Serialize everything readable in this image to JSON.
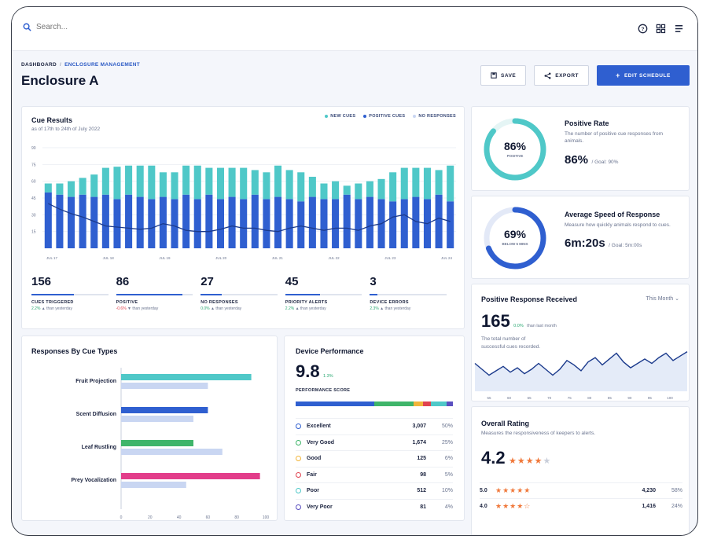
{
  "search": {
    "placeholder": "Search..."
  },
  "breadcrumb": {
    "root": "DASHBOARD",
    "current": "ENCLOSURE MANAGEMENT"
  },
  "page": {
    "title": "Enclosure A"
  },
  "actions": {
    "save": "SAVE",
    "export": "EXPORT",
    "edit": "EDIT SCHEDULE"
  },
  "colors": {
    "primary": "#2f5fd0",
    "teal": "#4fc8c8",
    "lightBlue": "#c9d6f2",
    "green": "#3fb56a",
    "pink": "#e23d8a",
    "orange": "#f0783a"
  },
  "cue_results": {
    "title": "Cue Results",
    "subtitle": "as of 17th to 24th of July 2022",
    "legend": [
      "NEW CUES",
      "POSITIVE CUES",
      "NO RESPONSES"
    ]
  },
  "stats": [
    {
      "value": "156",
      "label": "CUES TRIGGERED",
      "change": "2.2%",
      "change_suffix": "than yesterday",
      "dir": "up",
      "fill": 0.55
    },
    {
      "value": "86",
      "label": "POSITIVE",
      "change": "-0.6%",
      "change_suffix": "than yesterday",
      "dir": "down",
      "fill": 0.86
    },
    {
      "value": "27",
      "label": "NO RESPONSES",
      "change": "0.0%",
      "change_suffix": "than yesterday",
      "dir": "up",
      "fill": 0.27
    },
    {
      "value": "45",
      "label": "PRIORITY ALERTS",
      "change": "2.2%",
      "change_suffix": "than yesterday",
      "dir": "up",
      "fill": 0.45
    },
    {
      "value": "3",
      "label": "DEVICE ERRORS",
      "change": "2.3%",
      "change_suffix": "than yesterday",
      "dir": "up",
      "fill": 0.1
    }
  ],
  "positive_rate": {
    "ring_value": "86%",
    "ring_label": "POSITIVE",
    "title": "Positive Rate",
    "desc": "The number of positive cue responses from animals.",
    "big": "86%",
    "goal": "/ Goal: 90%",
    "fraction": 0.86
  },
  "speed": {
    "ring_value": "69%",
    "ring_label": "BELOW 5 MINS",
    "title": "Average Speed of Response",
    "desc": "Measure how quickly animals respond to cues.",
    "big": "6m:20s",
    "goal": "/ Goal: 5m:00s",
    "fraction": 0.69
  },
  "response_received": {
    "title": "Positive Response Received",
    "period": "This Month",
    "value": "165",
    "change": "0.0%",
    "change_suffix": "than last month",
    "desc_line1": "The total number of",
    "desc_line2": "successful cues recorded."
  },
  "overall": {
    "title": "Overall Rating",
    "desc": "Measures the responsiveness of keepers to alerts.",
    "value": "4.2",
    "rows": [
      {
        "score": "5.0",
        "stars": "★★★★★",
        "count": "4,230",
        "pct": "58%"
      },
      {
        "score": "4.0",
        "stars": "★★★★☆",
        "count": "1,416",
        "pct": "24%"
      }
    ]
  },
  "device_performance": {
    "title": "Device Performance",
    "score": "9.8",
    "score_change": "1.3%",
    "score_label": "PERFORMANCE SCORE",
    "rows": [
      {
        "name": "Excellent",
        "count": "3,007",
        "pct": "50%",
        "color": "#2f5fd0"
      },
      {
        "name": "Very Good",
        "count": "1,674",
        "pct": "25%",
        "color": "#3fb56a"
      },
      {
        "name": "Good",
        "count": "125",
        "pct": "6%",
        "color": "#f2b53a"
      },
      {
        "name": "Fair",
        "count": "98",
        "pct": "5%",
        "color": "#e0424f"
      },
      {
        "name": "Poor",
        "count": "512",
        "pct": "10%",
        "color": "#4fc8c8"
      },
      {
        "name": "Very Poor",
        "count": "81",
        "pct": "4%",
        "color": "#5a4fc0"
      }
    ]
  },
  "chart_data": [
    {
      "type": "bar",
      "title": "Cue Results",
      "ylim": [
        0,
        90
      ],
      "yticks": [
        "90",
        "75",
        "60",
        "45",
        "30",
        "15"
      ],
      "xtick_labels": [
        "JUL 17",
        "JUL 18",
        "JUL 19",
        "JUL 20",
        "JUL 21",
        "JUL 22",
        "JUL 23",
        "JUL 24"
      ],
      "series": [
        {
          "name": "POSITIVE CUES",
          "values": [
            50,
            48,
            46,
            48,
            46,
            48,
            44,
            48,
            46,
            44,
            46,
            44,
            48,
            44,
            48,
            44,
            46,
            44,
            48,
            44,
            46,
            44,
            42,
            46,
            44,
            44,
            48,
            44,
            46,
            44,
            42,
            44,
            46,
            44,
            48,
            42
          ]
        },
        {
          "name": "NEW CUES",
          "values": [
            8,
            10,
            14,
            15,
            20,
            24,
            29,
            26,
            28,
            30,
            22,
            24,
            26,
            30,
            24,
            28,
            26,
            28,
            22,
            24,
            28,
            26,
            26,
            18,
            14,
            16,
            8,
            14,
            14,
            18,
            26,
            28,
            26,
            28,
            22,
            32
          ]
        },
        {
          "name": "NO RESPONSES",
          "values": [
            40,
            35,
            31,
            28,
            24,
            20,
            19,
            18,
            17,
            18,
            22,
            20,
            16,
            15,
            15,
            17,
            20,
            18,
            18,
            16,
            15,
            18,
            20,
            18,
            16,
            18,
            18,
            16,
            20,
            22,
            28,
            30,
            24,
            22,
            27,
            24
          ]
        }
      ],
      "grid": true
    },
    {
      "type": "bar",
      "orientation": "horizontal",
      "title": "Responses By Cue Types",
      "categories": [
        "Fruit Projection",
        "Scent Diffusion",
        "Leaf Rustling",
        "Prey Vocalization"
      ],
      "series": [
        {
          "values": [
            90,
            60,
            50,
            96
          ],
          "colors": [
            "#4fc8c8",
            "#2f5fd0",
            "#3fb56a",
            "#e23d8a"
          ]
        },
        {
          "values": [
            60,
            50,
            70,
            45
          ]
        }
      ],
      "xlim": [
        0,
        100
      ],
      "xticks": [
        "0",
        "20",
        "40",
        "60",
        "80",
        "100"
      ]
    },
    {
      "type": "area",
      "title": "Positive Response Received",
      "xtick_labels": [
        "55",
        "60",
        "65",
        "70",
        "75",
        "80",
        "85",
        "90",
        "95",
        "100"
      ],
      "values": [
        38,
        30,
        22,
        28,
        34,
        26,
        32,
        24,
        30,
        38,
        30,
        22,
        30,
        42,
        36,
        28,
        40,
        46,
        36,
        44,
        52,
        40,
        32,
        38,
        44,
        38,
        46,
        52,
        42,
        48,
        54
      ]
    },
    {
      "type": "bar",
      "orientation": "stacked-horizontal",
      "title": "Device Performance",
      "categories": [
        "Excellent",
        "Very Good",
        "Good",
        "Fair",
        "Poor",
        "Very Poor"
      ],
      "values": [
        50,
        25,
        6,
        5,
        10,
        4
      ]
    }
  ]
}
